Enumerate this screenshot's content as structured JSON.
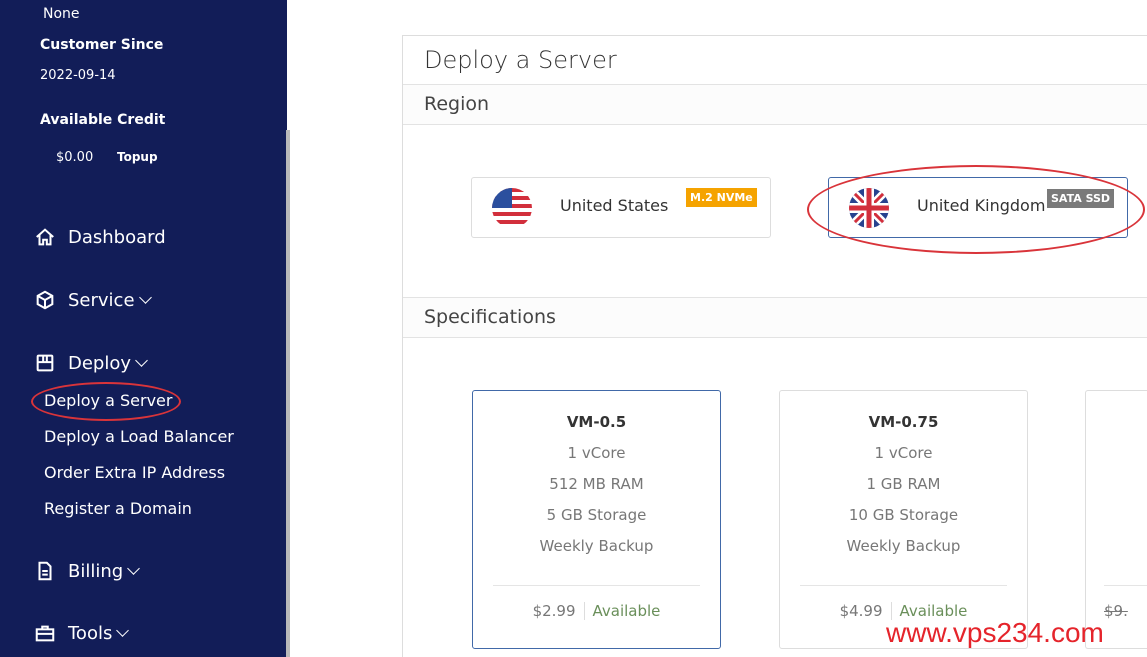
{
  "sidebar": {
    "affiliate_value": "None",
    "customer_since_label": "Customer Since",
    "customer_since": "2022-09-14",
    "credit_label": "Available Credit",
    "credit": "$0.00",
    "topup": "Topup",
    "nav": [
      {
        "label": "Dashboard",
        "icon": "home-icon"
      },
      {
        "label": "Service",
        "icon": "cube-icon"
      },
      {
        "label": "Deploy",
        "icon": "box-icon"
      },
      {
        "label": "Billing",
        "icon": "document-icon"
      },
      {
        "label": "Tools",
        "icon": "toolbox-icon"
      }
    ],
    "deploy_items": [
      "Deploy a Server",
      "Deploy a Load Balancer",
      "Order Extra IP Address",
      "Register a Domain"
    ]
  },
  "main": {
    "title": "Deploy a Server",
    "region_header": "Region",
    "regions": [
      {
        "name": "United States",
        "badge": "M.2 NVMe",
        "badge_color": "#f5a300",
        "selected": false
      },
      {
        "name": "United Kingdom",
        "badge": "SATA SSD",
        "badge_color": "#7a7a7a",
        "selected": true
      }
    ],
    "spec_header": "Specifications",
    "plans": [
      {
        "name": "VM-0.5",
        "cpu": "1 vCore",
        "ram": "512 MB RAM",
        "storage": "5 GB Storage",
        "backup": "Weekly Backup",
        "price": "$2.99",
        "status": "Available"
      },
      {
        "name": "VM-0.75",
        "cpu": "1 vCore",
        "ram": "1 GB RAM",
        "storage": "10 GB Storage",
        "backup": "Weekly Backup",
        "price": "$4.99",
        "status": "Available"
      },
      {
        "price": "$9."
      }
    ]
  },
  "watermark": "www.vps234.com",
  "colors": {
    "sidebar": "#121d58",
    "selected_border": "#4169a8",
    "annotation": "#d9343a"
  }
}
